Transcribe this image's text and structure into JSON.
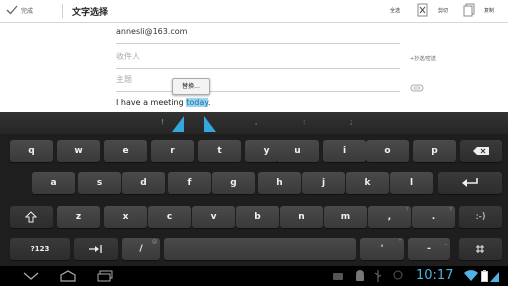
{
  "topbar": {
    "done_label": "完成",
    "title": "文字选择",
    "select_all": "全选",
    "cut": "剪切",
    "copy": "复制"
  },
  "form": {
    "from_value": "annesli@163.com",
    "to_placeholder": "收件人",
    "cc_bcc": "+抄送/密送",
    "subject_placeholder": "主题",
    "replace_popup": "替换...",
    "body_before": "I have a meeting ",
    "body_selected": "today",
    "body_after": "."
  },
  "suggestions": [
    "!",
    ",",
    ":",
    ";"
  ],
  "keyboard": {
    "row1": [
      "q",
      "w",
      "e",
      "r",
      "t",
      "y",
      "u",
      "i",
      "o",
      "p"
    ],
    "row2": [
      "a",
      "s",
      "d",
      "f",
      "g",
      "h",
      "j",
      "k",
      "l"
    ],
    "row3": [
      "z",
      "x",
      "c",
      "v",
      "b",
      "n",
      "m"
    ],
    "row3_punct": [
      ",",
      "."
    ],
    "row3_punct_sup": [
      "!",
      "?"
    ],
    "smiley": ":-)",
    "sym": "?123",
    "slash": "/",
    "slash_sup": "@",
    "apostrophe": "'",
    "apostrophe_sup": "\"",
    "dash": "-",
    "dash_sup": "_"
  },
  "status": {
    "time": "10:17"
  }
}
